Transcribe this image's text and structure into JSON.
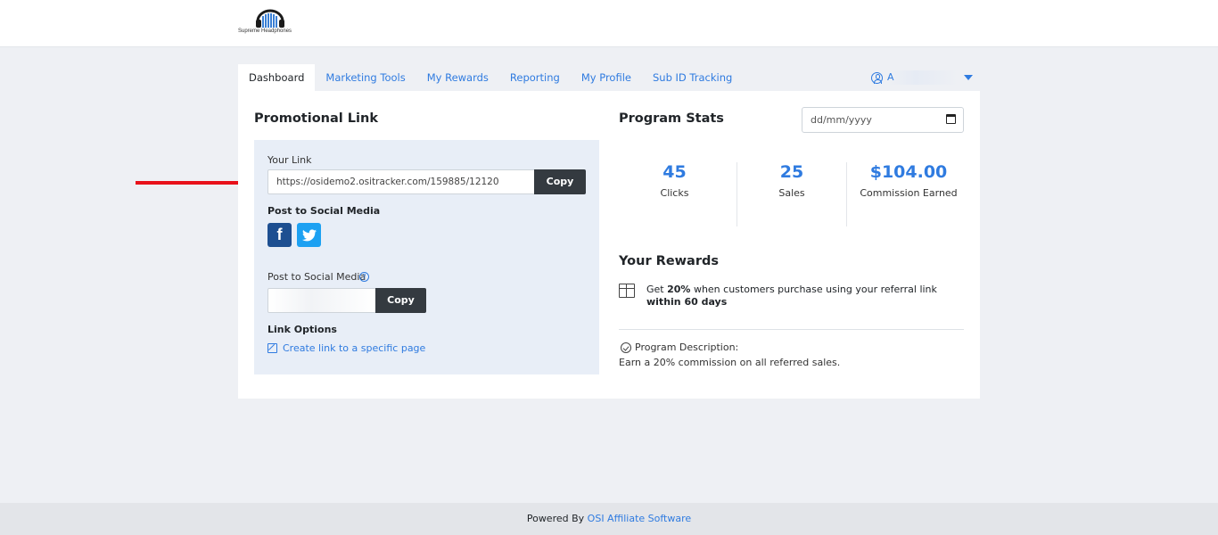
{
  "brand": {
    "name": "Supreme Headphones"
  },
  "nav": {
    "tabs": [
      {
        "label": "Dashboard",
        "active": true
      },
      {
        "label": "Marketing Tools"
      },
      {
        "label": "My Rewards"
      },
      {
        "label": "Reporting"
      },
      {
        "label": "My Profile"
      },
      {
        "label": "Sub ID Tracking"
      }
    ],
    "user_name": "A"
  },
  "promo": {
    "title": "Promotional Link",
    "your_link_label": "Your Link",
    "link_value": "https://osidemo2.ositracker.com/159885/12120",
    "copy_label": "Copy",
    "social_label": "Post to Social Media",
    "social_label2": "Post to Social Media",
    "social_copy_label": "Copy",
    "link_options_label": "Link Options",
    "create_link_label": "Create link to a specific page",
    "help_icon": "?"
  },
  "stats": {
    "title": "Program Stats",
    "date_placeholder": "dd/mm/yyyy",
    "items": [
      {
        "value": "45",
        "label": "Clicks"
      },
      {
        "value": "25",
        "label": "Sales"
      },
      {
        "value": "$104.00",
        "label": "Commission Earned"
      }
    ]
  },
  "rewards": {
    "title": "Your Rewards",
    "text_prefix": "Get ",
    "percent": "20%",
    "text_mid": " when customers purchase using your referral link ",
    "text_bold_end": "within 60 days"
  },
  "program": {
    "desc_label": "Program Description:",
    "desc_text": "Earn a 20% commission on all referred sales."
  },
  "footer": {
    "prefix": "Powered By ",
    "link": "OSI Affiliate Software"
  },
  "colors": {
    "accent": "#2f7be0",
    "dark_button": "#343a40",
    "panel": "#e8eef7",
    "arrow": "#e8111a"
  },
  "icons": [
    "headphones-logo-icon",
    "user-circle-icon",
    "caret-down-icon",
    "facebook-icon",
    "twitter-icon",
    "help-icon",
    "edit-icon",
    "calendar-icon",
    "gift-icon",
    "check-circle-icon",
    "red-arrow-icon"
  ]
}
